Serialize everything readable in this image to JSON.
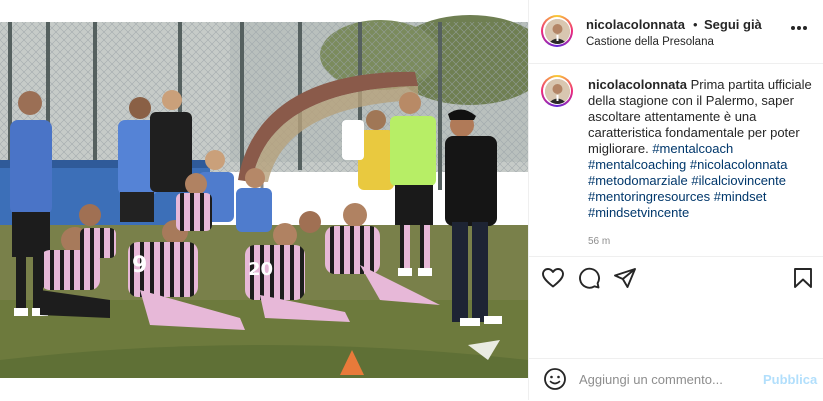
{
  "post": {
    "photo": {
      "description_icon": "photo",
      "jersey_numbers": [
        "9",
        "20"
      ]
    },
    "header": {
      "username": "nicolacolonnata",
      "separator": "•",
      "follow_label": "Segui già",
      "location": "Castione della Presolana",
      "more_icon": "more-horizontal-icon"
    },
    "caption": {
      "username": "nicolacolonnata",
      "text": "Prima partita ufficiale della stagione con il Palermo, saper ascoltare attentamente è una caratteristica fondamentale per poter migliorare.",
      "hashtags": [
        "#mentalcoach",
        "#mentalcoaching",
        "#nicolacolonnata",
        "#metodomarziale",
        "#ilcalciovincente",
        "#mentoringresources",
        "#mindset",
        "#mindsetvincente"
      ],
      "time": "56 m"
    },
    "actions": {
      "like_icon": "heart-icon",
      "comment_icon": "comment-icon",
      "share_icon": "share-icon",
      "save_icon": "bookmark-icon"
    },
    "comment_bar": {
      "emoji_icon": "emoji-icon",
      "placeholder": "Aggiungi un commento...",
      "publish_label": "Pubblica"
    }
  }
}
